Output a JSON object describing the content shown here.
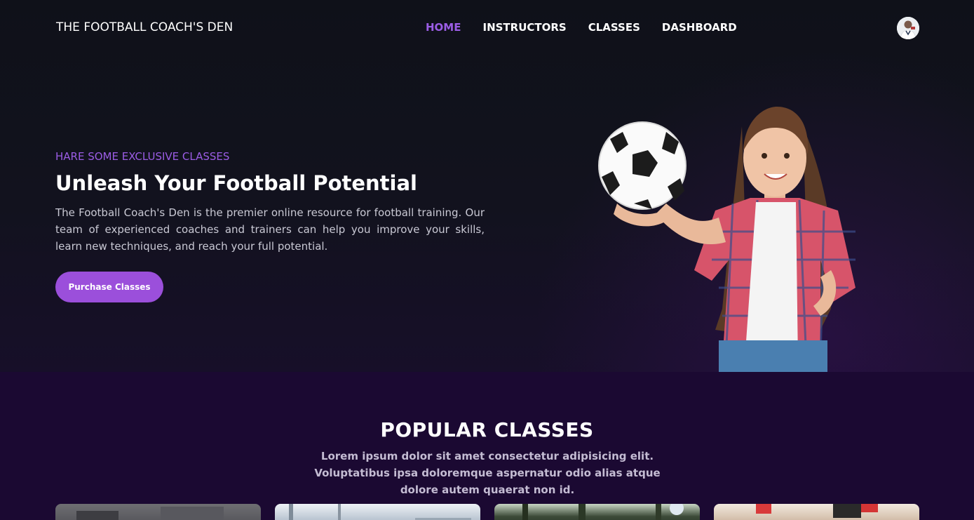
{
  "navbar": {
    "brand": "THE FOOTBALL COACH'S DEN",
    "links": [
      {
        "label": "HOME",
        "active": true
      },
      {
        "label": "INSTRUCTORS",
        "active": false
      },
      {
        "label": "CLASSES",
        "active": false
      },
      {
        "label": "DASHBOARD",
        "active": false
      }
    ],
    "avatar_icon": "user-avatar"
  },
  "hero": {
    "eyebrow": "HARE SOME EXCLUSIVE CLASSES",
    "title": "Unleash Your Football Potential",
    "body": "The Football Coach's Den is the premier online resource for football training. Our team of experienced coaches and trainers can help you improve your skills, learn new techniques, and reach your full potential.",
    "cta_label": "Purchase Classes",
    "illustration": "girl-holding-soccer-ball"
  },
  "popular": {
    "title": "POPULAR CLASSES",
    "subtitle": "Lorem ipsum dolor sit amet consectetur adipisicing elit. Voluptatibus ipsa doloremque aspernatur odio alias atque dolore autem quaerat non id.",
    "cards": [
      {
        "image": "class-photo-1"
      },
      {
        "image": "class-photo-2"
      },
      {
        "image": "class-photo-3"
      },
      {
        "image": "class-photo-4"
      }
    ]
  },
  "colors": {
    "accent": "#9b5de5",
    "button": "#9b4fdb",
    "hero_bg": "#0f111a",
    "section_bg": "#1b0932"
  }
}
